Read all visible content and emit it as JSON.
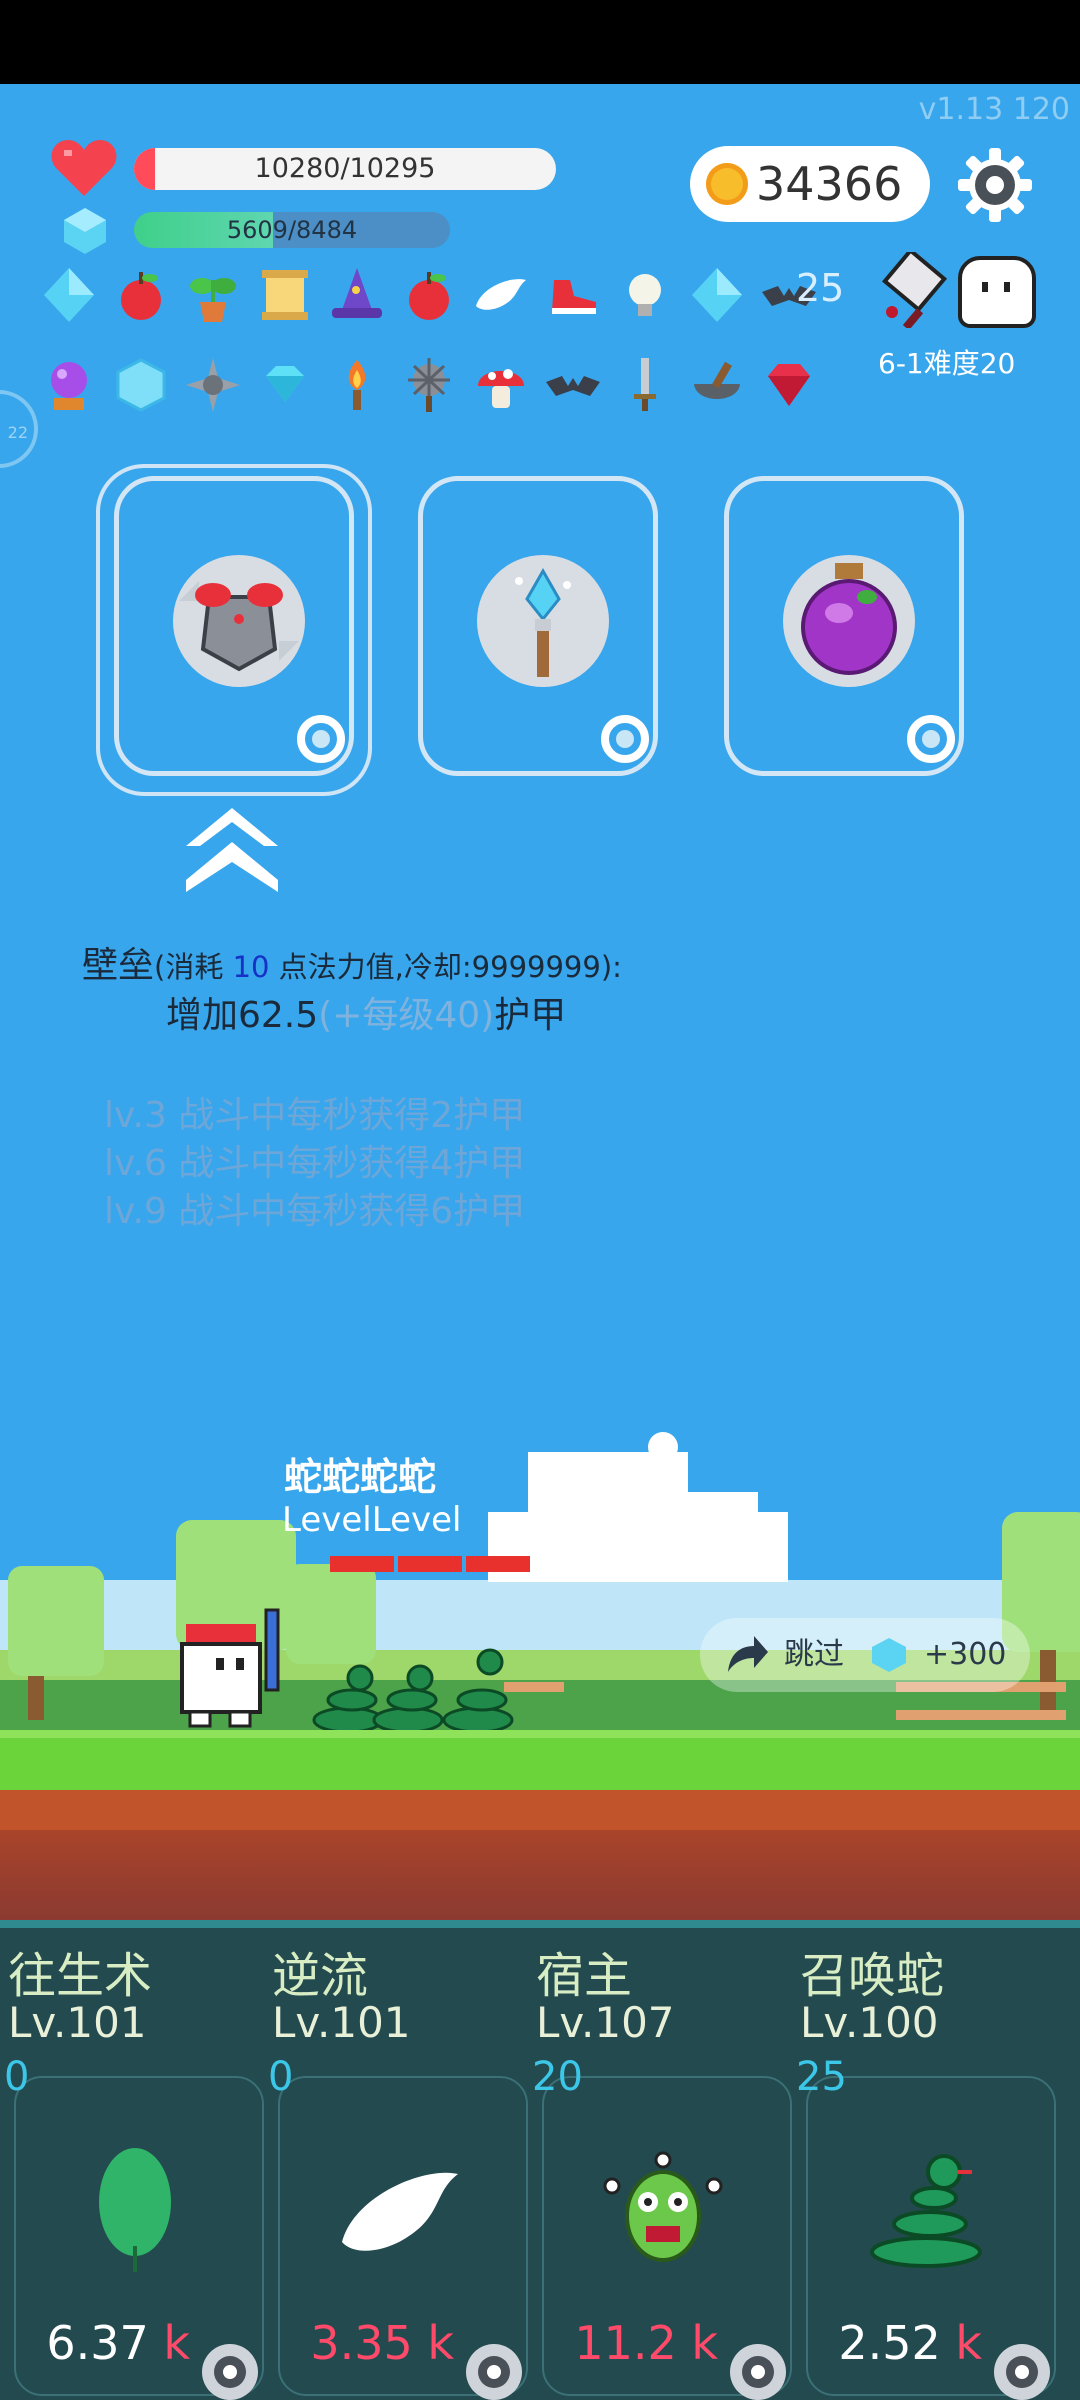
{
  "version": "v1.13 120",
  "hp": {
    "current": 10280,
    "max": 10295,
    "text": "10280/10295",
    "fill_fraction": 0.05
  },
  "mp": {
    "current": 5609,
    "max": 8484,
    "text": "5609/8484",
    "fill_fraction": 0.44
  },
  "coins": "34366",
  "settings_icon": "gear-icon",
  "inventory_row1": [
    "diamond",
    "apple",
    "plant-pot",
    "scroll",
    "wizard-hat",
    "apple",
    "wing",
    "red-shoe",
    "light-bulb",
    "diamond",
    "bat"
  ],
  "inventory_row2": [
    "crystal-ball",
    "ice-cube",
    "spiked-mine",
    "small-diamond",
    "torch",
    "spiked-club",
    "mushroom",
    "bat",
    "sword",
    "mortar-pestle",
    "ruby"
  ],
  "item_count": "25",
  "stage": "6-1难度20",
  "side_tab": "22",
  "skill_cards": [
    {
      "name": "armor-skill",
      "icon": "armor-icon"
    },
    {
      "name": "ice-wand-skill",
      "icon": "wand-icon"
    },
    {
      "name": "poison-potion-skill",
      "icon": "potion-icon"
    }
  ],
  "description": {
    "title": "壁垒",
    "cost_prefix": "(消耗 ",
    "cost_value": "10",
    "cost_suffix": " 点法力值,冷却:9999999):",
    "effect_prefix": "增加62.5",
    "effect_grey": "(+每级40)",
    "effect_suffix": "护甲",
    "levels": [
      "lv.3 战斗中每秒获得2护甲",
      "lv.6 战斗中每秒获得4护甲",
      "lv.9 战斗中每秒获得6护甲"
    ]
  },
  "battle": {
    "enemy_name": "蛇蛇蛇蛇",
    "enemy_level": "LevelLevel",
    "skip_label": "跳过",
    "skip_reward": "+300"
  },
  "skills": [
    {
      "name": "往生术",
      "level": "Lv.101",
      "cost": "0",
      "price": "6.37",
      "unit": "k",
      "price_red": false,
      "icon": "leaf-icon"
    },
    {
      "name": "逆流",
      "level": "Lv.101",
      "cost": "0",
      "price": "3.35",
      "unit": "k",
      "price_red": true,
      "icon": "wing-icon"
    },
    {
      "name": "宿主",
      "level": "Lv.107",
      "cost": "20",
      "price": "11.2",
      "unit": "k",
      "price_red": true,
      "icon": "monster-icon"
    },
    {
      "name": "召唤蛇",
      "level": "Lv.100",
      "cost": "25",
      "price": "2.52",
      "unit": "k",
      "price_red": false,
      "icon": "snake-icon"
    }
  ],
  "colors": {
    "background": "#38a6ec",
    "panel": "#234a4f",
    "hp": "#ff4b5a",
    "mp": "#3fd08a",
    "grass": "#6bd43b"
  }
}
